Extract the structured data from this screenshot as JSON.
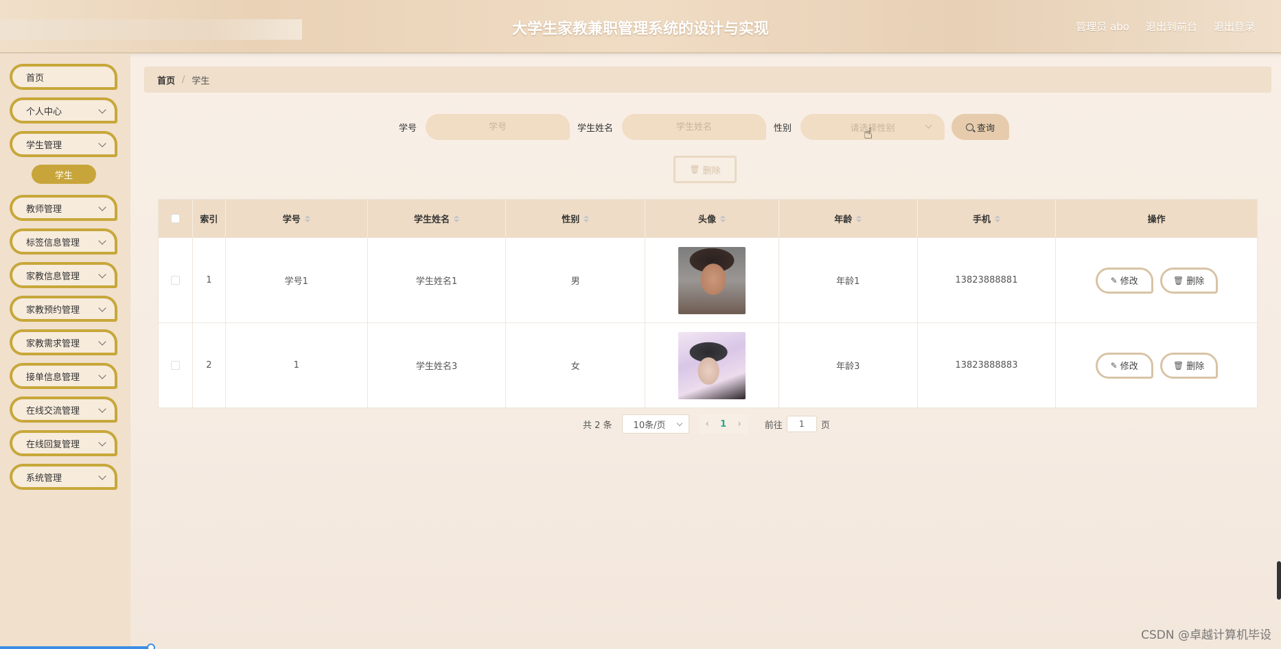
{
  "header": {
    "title": "大学生家教兼职管理系统的设计与实现",
    "user_label": "管理员 abo",
    "to_front_label": "退出到前台",
    "logout_label": "退出登录"
  },
  "sidebar": {
    "items": [
      {
        "label": "首页"
      },
      {
        "label": "个人中心"
      },
      {
        "label": "学生管理"
      },
      {
        "label": "教师管理"
      },
      {
        "label": "标签信息管理"
      },
      {
        "label": "家教信息管理"
      },
      {
        "label": "家教预约管理"
      },
      {
        "label": "家教需求管理"
      },
      {
        "label": "接单信息管理"
      },
      {
        "label": "在线交流管理"
      },
      {
        "label": "在线回复管理"
      },
      {
        "label": "系统管理"
      }
    ],
    "active_sub": "学生"
  },
  "breadcrumb": {
    "home": "首页",
    "separator": "/",
    "current": "学生"
  },
  "search": {
    "student_no_label": "学号",
    "student_no_placeholder": "学号",
    "student_name_label": "学生姓名",
    "student_name_placeholder": "学生姓名",
    "gender_label": "性别",
    "gender_placeholder": "请选择性别",
    "query_label": "查询"
  },
  "batch_delete_label": "删除",
  "table": {
    "headers": {
      "index": "索引",
      "student_no": "学号",
      "student_name": "学生姓名",
      "gender": "性别",
      "avatar": "头像",
      "age": "年龄",
      "phone": "手机",
      "operation": "操作"
    },
    "rows": [
      {
        "index": "1",
        "student_no": "学号1",
        "student_name": "学生姓名1",
        "gender": "男",
        "age": "年龄1",
        "phone": "13823888881",
        "edit": "修改",
        "delete": "删除"
      },
      {
        "index": "2",
        "student_no": "1",
        "student_name": "学生姓名3",
        "gender": "女",
        "age": "年龄3",
        "phone": "13823888883",
        "edit": "修改",
        "delete": "删除"
      }
    ]
  },
  "pagination": {
    "total": "共 2 条",
    "page_size": "10条/页",
    "current_page": "1",
    "goto_label": "前往",
    "goto_value": "1",
    "page_unit": "页"
  },
  "watermark": "CSDN @卓越计算机毕设",
  "colors": {
    "accent_gold": "#c7a73a",
    "header_bg": "#e9d2b6",
    "table_header_bg": "#efdcc6",
    "active_page": "#2ba58c"
  }
}
